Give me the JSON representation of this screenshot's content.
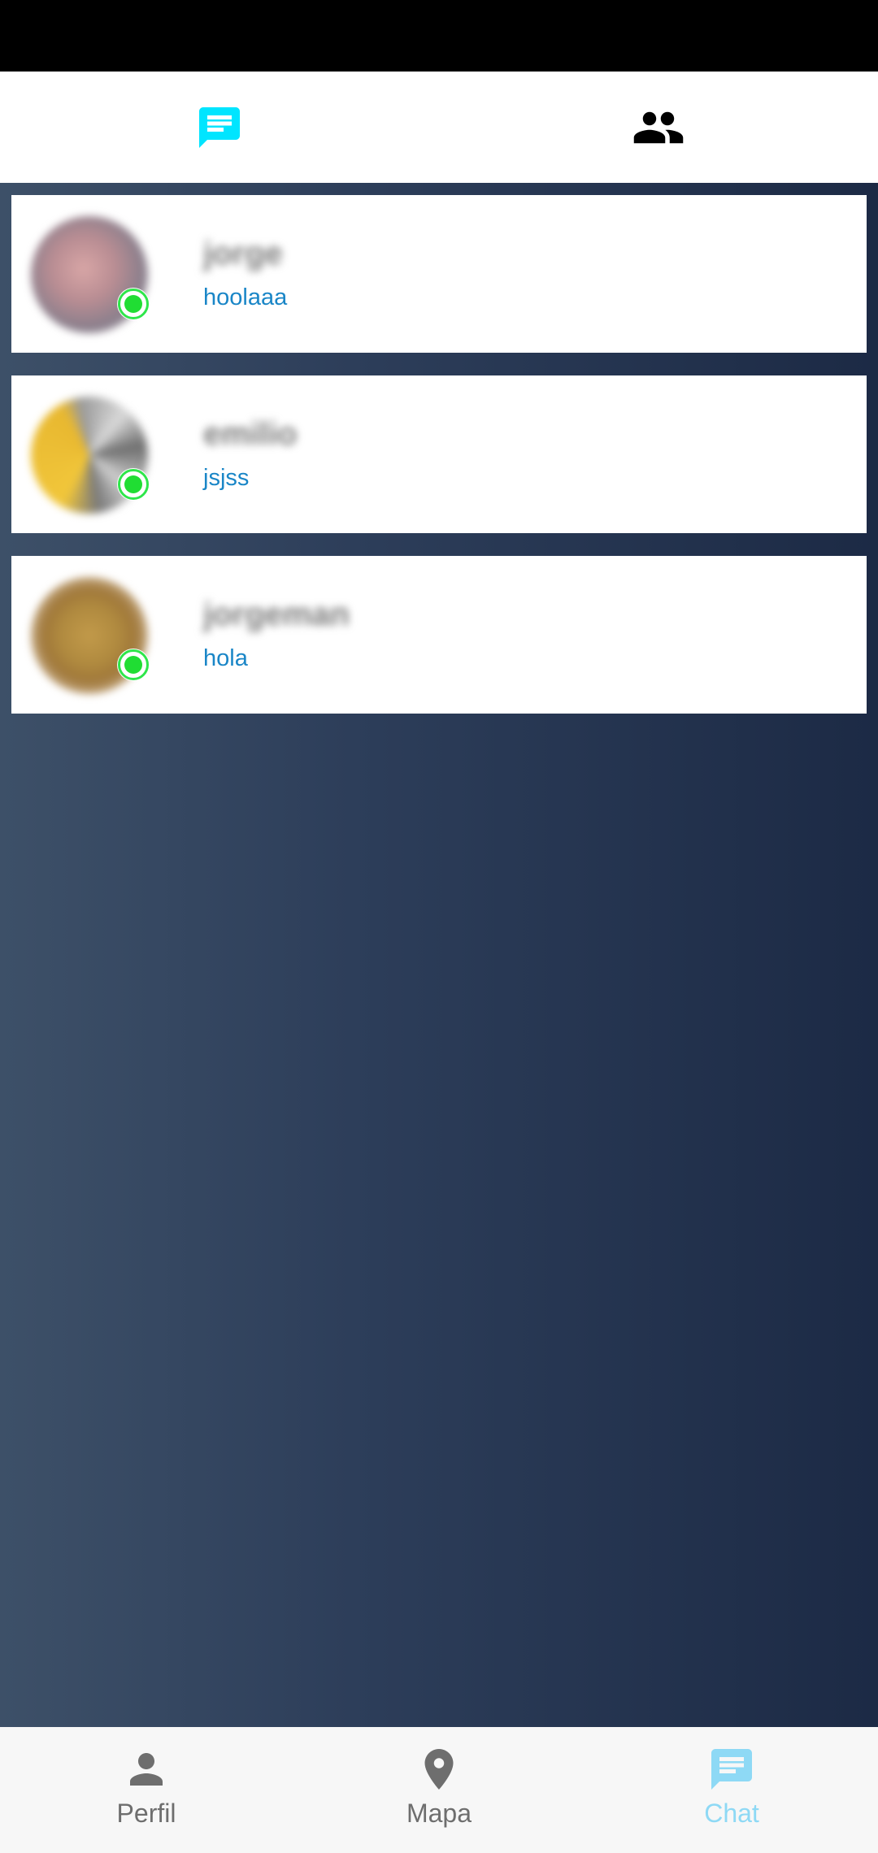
{
  "colors": {
    "accent_cyan": "#00e5ff",
    "active_nav": "#8ed9f5",
    "message_text": "#1a86c7",
    "online_green": "#20dd33",
    "background_start": "#3d5068",
    "background_end": "#1c2a45"
  },
  "top_tabs": [
    {
      "icon": "chat-icon",
      "active": true
    },
    {
      "icon": "group-icon",
      "active": false
    }
  ],
  "chats": [
    {
      "name": "jorge",
      "last_message": "hoolaaa",
      "online": true
    },
    {
      "name": "emilio",
      "last_message": "jsjss",
      "online": true
    },
    {
      "name": "jorgeman",
      "last_message": "hola",
      "online": true
    }
  ],
  "bottom_nav": [
    {
      "label": "Perfil",
      "icon": "person-icon",
      "active": false
    },
    {
      "label": "Mapa",
      "icon": "location-pin-icon",
      "active": false
    },
    {
      "label": "Chat",
      "icon": "chat-icon",
      "active": true
    }
  ]
}
